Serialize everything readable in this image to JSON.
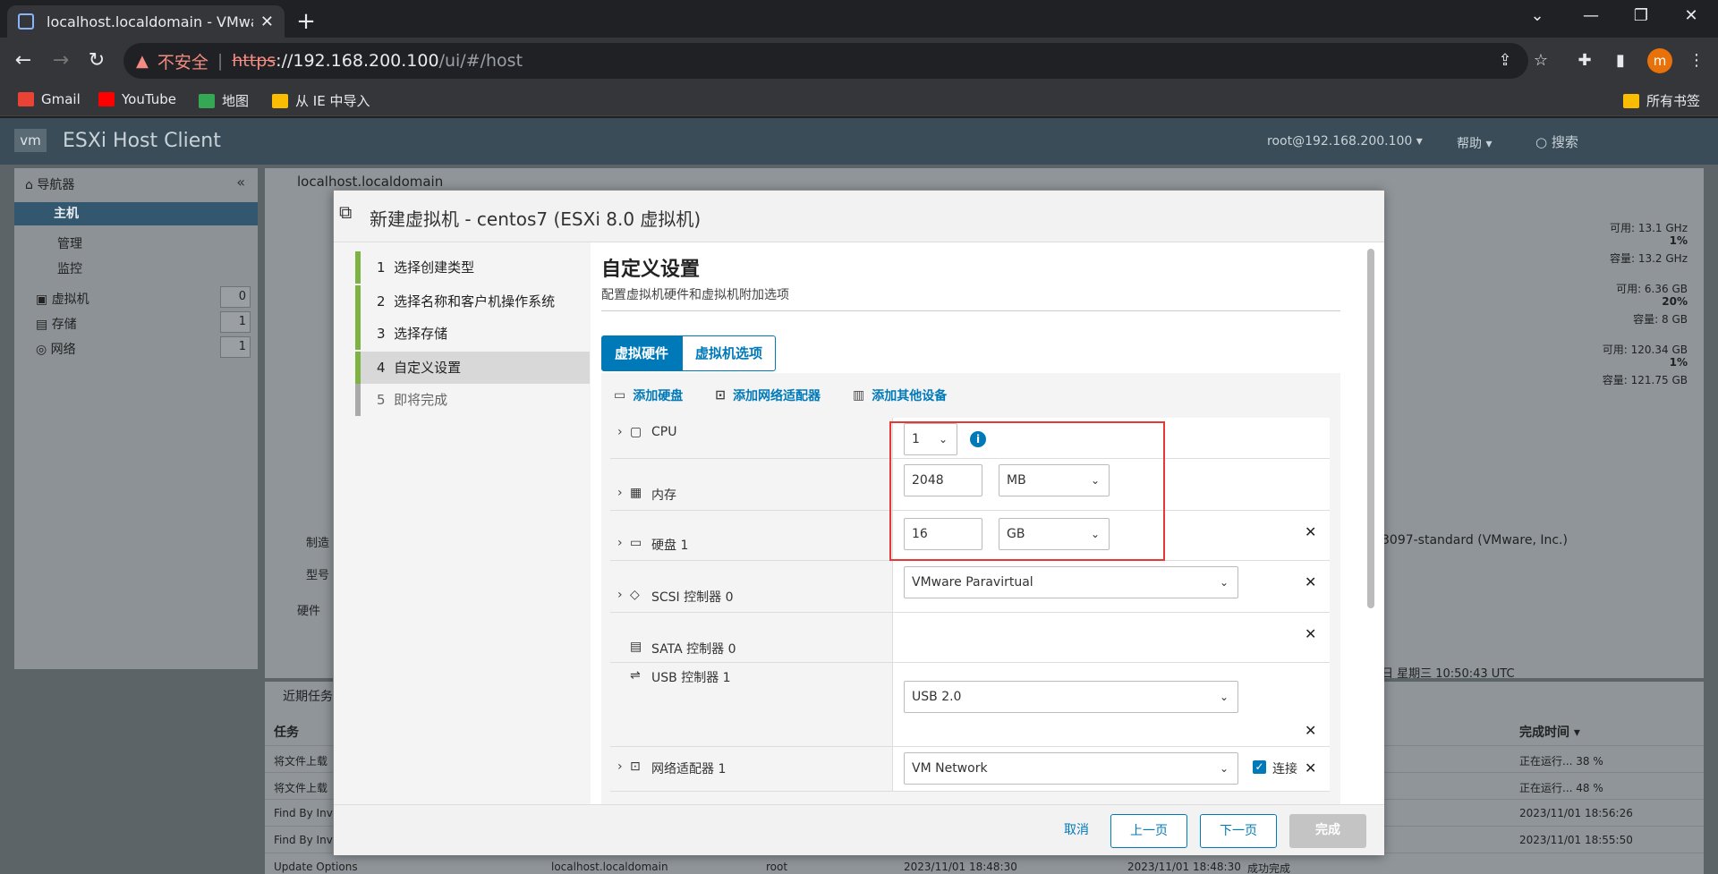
{
  "browser": {
    "tab_title": "localhost.localdomain - VMware ESXi",
    "tab_close": "✕",
    "new_tab": "+",
    "address": {
      "insecure_label": "不安全",
      "separator": "|",
      "protocol": "https",
      "host": "://192.168.200.100",
      "path": "/ui/#/host"
    },
    "bookmarks": [
      {
        "label": "Gmail",
        "color": "#ea4335"
      },
      {
        "label": "YouTube",
        "color": "#ff0000"
      },
      {
        "label": "地图",
        "color": "#34a853"
      },
      {
        "label": "从 IE 中导入",
        "color": "#fbbc04"
      }
    ],
    "all_bookmarks": "所有书签",
    "avatar_letter": "m"
  },
  "esxi": {
    "logo": "vm",
    "app_title": "ESXi Host Client",
    "user": "root@192.168.200.100 ▾",
    "help": "帮助 ▾",
    "search": "搜索"
  },
  "navigator": {
    "title": "导航器",
    "host": "主机",
    "host_sub": [
      "管理",
      "监控"
    ],
    "items": [
      {
        "label": "虚拟机",
        "count": "0",
        "icon": "vm-icon"
      },
      {
        "label": "存储",
        "count": "1",
        "icon": "storage-icon"
      },
      {
        "label": "网络",
        "count": "1",
        "icon": "network-icon"
      }
    ]
  },
  "main": {
    "title": "localhost.localdomain",
    "stats": [
      "可用: 13.1 GHz",
      "1%",
      "容量: 13.2 GHz",
      "可用: 6.36 GB",
      "20%",
      "容量: 8 GB",
      "可用: 120.34 GB",
      "1%",
      "容量: 121.75 GB"
    ],
    "hw_section": "硬件",
    "maker_partial": "制造",
    "model_partial": "型号",
    "vmware_std": "3097-standard (VMware, Inc.)",
    "date_partial": "日 星期三 10:50:43 UTC"
  },
  "recent_tasks": {
    "title": "近期任务",
    "col_task": "任务",
    "col_done": "完成时间 ▾",
    "rows": [
      {
        "task": "将文件上载",
        "status": "正在运行... 38 %"
      },
      {
        "task": "将文件上载",
        "status": "正在运行... 48 %"
      },
      {
        "task": "Find By Inv",
        "status": "2023/11/01 18:56:26"
      },
      {
        "task": "Find By Inv",
        "status": "2023/11/01 18:55:50"
      },
      {
        "task": "Update Options",
        "target": "localhost.localdomain",
        "user": "root",
        "start": "2023/11/01 18:48:30",
        "queued": "2023/11/01 18:48:30",
        "result": "成功完成"
      }
    ]
  },
  "wizard": {
    "title": "新建虚拟机 - centos7 (ESXi 8.0 虚拟机)",
    "steps": [
      {
        "num": "1",
        "label": "选择创建类型"
      },
      {
        "num": "2",
        "label": "选择名称和客户机操作系统"
      },
      {
        "num": "3",
        "label": "选择存储"
      },
      {
        "num": "4",
        "label": "自定义设置"
      },
      {
        "num": "5",
        "label": "即将完成"
      }
    ],
    "content_title": "自定义设置",
    "content_subtitle": "配置虚拟机硬件和虚拟机附加选项",
    "tabs": {
      "hardware": "虚拟硬件",
      "options": "虚拟机选项"
    },
    "actions": {
      "add_disk": "添加硬盘",
      "add_nic": "添加网络适配器",
      "add_other": "添加其他设备"
    },
    "hardware": {
      "cpu": {
        "label": "CPU",
        "value": "1"
      },
      "memory": {
        "label": "内存",
        "value": "2048",
        "unit": "MB"
      },
      "disk": {
        "label": "硬盘 1",
        "value": "16",
        "unit": "GB"
      },
      "scsi": {
        "label": "SCSI 控制器 0",
        "value": "VMware Paravirtual"
      },
      "sata": {
        "label": "SATA 控制器 0"
      },
      "usb": {
        "label": "USB 控制器 1",
        "value": "USB 2.0"
      },
      "nic": {
        "label": "网络适配器 1",
        "value": "VM Network",
        "connect": "连接"
      }
    },
    "footer": {
      "cancel": "取消",
      "back": "上一页",
      "next": "下一页",
      "finish": "完成"
    }
  }
}
